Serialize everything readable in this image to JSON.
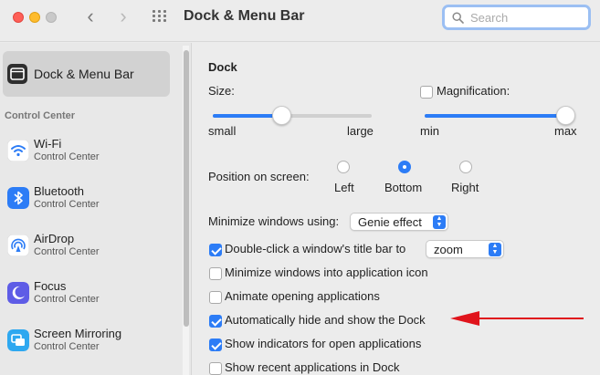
{
  "window": {
    "title": "Dock & Menu Bar"
  },
  "search": {
    "placeholder": "Search",
    "value": ""
  },
  "sidebar": {
    "selected": {
      "label": "Dock & Menu Bar",
      "icon": "dock-menubar-icon"
    },
    "section_header": "Control Center",
    "items": [
      {
        "label": "Wi-Fi",
        "sub": "Control Center",
        "icon": "wifi-icon"
      },
      {
        "label": "Bluetooth",
        "sub": "Control Center",
        "icon": "bluetooth-icon"
      },
      {
        "label": "AirDrop",
        "sub": "Control Center",
        "icon": "airdrop-icon"
      },
      {
        "label": "Focus",
        "sub": "Control Center",
        "icon": "focus-moon-icon"
      },
      {
        "label": "Screen Mirroring",
        "sub": "Control Center",
        "icon": "screen-mirroring-icon"
      }
    ]
  },
  "dock": {
    "section_title": "Dock",
    "size": {
      "label": "Size:",
      "min_label": "small",
      "max_label": "large",
      "value": 0.43
    },
    "magnification": {
      "label": "Magnification:",
      "checked": false,
      "min_label": "min",
      "max_label": "max",
      "value": 1.0
    },
    "position": {
      "label": "Position on screen:",
      "options": [
        "Left",
        "Bottom",
        "Right"
      ],
      "selected": "Bottom"
    },
    "minimize": {
      "label": "Minimize windows using:",
      "value": "Genie effect"
    },
    "double_click": {
      "label": "Double-click a window's title bar to",
      "checked": true,
      "value": "zoom"
    },
    "checkboxes": [
      {
        "label": "Minimize windows into application icon",
        "checked": false
      },
      {
        "label": "Animate opening applications",
        "checked": false
      },
      {
        "label": "Automatically hide and show the Dock",
        "checked": true
      },
      {
        "label": "Show indicators for open applications",
        "checked": true
      },
      {
        "label": "Show recent applications in Dock",
        "checked": false
      }
    ]
  },
  "colors": {
    "accent": "#2c7cf6",
    "annotation_arrow": "#e0141c"
  }
}
